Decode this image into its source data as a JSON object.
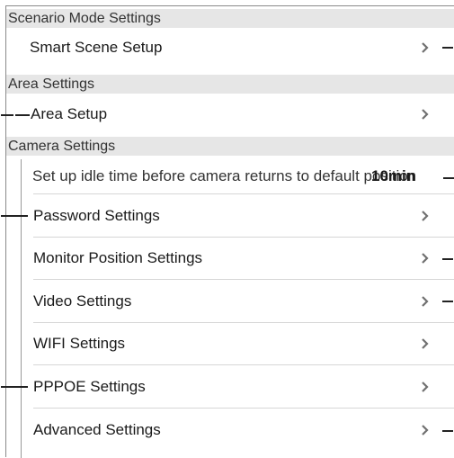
{
  "sections": {
    "scenario": {
      "title": "Scenario Mode Settings"
    },
    "area": {
      "title": "Area Settings"
    },
    "camera": {
      "title": "Camera Settings"
    }
  },
  "items": {
    "smart_scene": "Smart Scene Setup",
    "area_setup": "Area Setup",
    "idle_time": {
      "label": "Set up idle time before camera returns to default position",
      "value": "10min"
    },
    "password": "Password Settings",
    "monitor_position": "Monitor Position Settings",
    "video": "Video Settings",
    "wifi": "WIFI Settings",
    "pppoe": "PPPOE Settings",
    "advanced": "Advanced Settings"
  },
  "icons": {
    "row_chevron": "chevron-right-icon"
  },
  "colors": {
    "header_bg": "#e6e6e6",
    "divider": "#d6d6d6",
    "chevron": "#707070"
  }
}
